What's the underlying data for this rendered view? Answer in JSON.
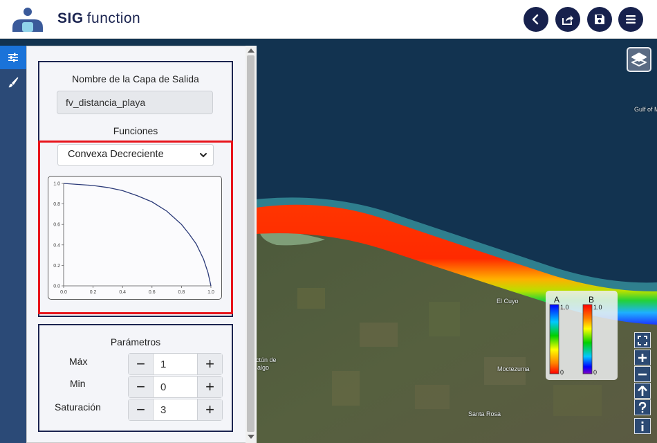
{
  "header": {
    "brand_bold": "SIG",
    "brand_rest": "function",
    "buttons": [
      "back",
      "share",
      "save",
      "menu"
    ]
  },
  "toolstrip": {
    "items": [
      "sliders-icon",
      "brush-icon"
    ],
    "active": "sliders-icon"
  },
  "panel": {
    "output_label": "Nombre de la Capa de Salida",
    "output_value": "fv_distancia_playa",
    "functions_label": "Funciones",
    "function_selected": "Convexa Decreciente",
    "parameters_label": "Parámetros",
    "params": [
      {
        "label": "Máx",
        "value": "1"
      },
      {
        "label": "Min",
        "value": "0"
      },
      {
        "label": "Saturación",
        "value": "3"
      }
    ],
    "minus": "−",
    "plus": "+"
  },
  "chart_data": {
    "type": "line",
    "title": "",
    "xlabel": "",
    "ylabel": "",
    "xlim": [
      0.0,
      1.0
    ],
    "ylim": [
      0.0,
      1.0
    ],
    "x_ticks": [
      "0.0",
      "0.2",
      "0.4",
      "0.6",
      "0.8",
      "1.0"
    ],
    "y_ticks": [
      "0.0",
      "0.2",
      "0.4",
      "0.6",
      "0.8",
      "1.0"
    ],
    "grid": false,
    "series": [
      {
        "color": "#2b3a78",
        "x": [
          0.0,
          0.1,
          0.2,
          0.3,
          0.4,
          0.5,
          0.6,
          0.7,
          0.8,
          0.85,
          0.9,
          0.95,
          0.98,
          1.0
        ],
        "y": [
          1.0,
          0.99,
          0.98,
          0.96,
          0.93,
          0.88,
          0.82,
          0.73,
          0.6,
          0.51,
          0.41,
          0.26,
          0.13,
          0.0
        ]
      }
    ]
  },
  "map": {
    "labels": [
      "Gulf of M",
      "El Cuyo",
      "Moctezuma",
      "Santa Rosa",
      "ctún de",
      "algo"
    ]
  },
  "legend": {
    "a_title": "A",
    "b_title": "B",
    "a_max": "1.0",
    "a_min": "0",
    "b_max": "1.0",
    "b_min": "0"
  },
  "map_controls": [
    "fullscreen-icon",
    "zoom-in-icon",
    "zoom-out-icon",
    "north-arrow-icon",
    "help-icon",
    "info-icon"
  ],
  "colors": {
    "brand": "#1b2450",
    "highlight": "#e8141b",
    "active_tool": "#1a73d9",
    "curve": "#2b3a78"
  }
}
